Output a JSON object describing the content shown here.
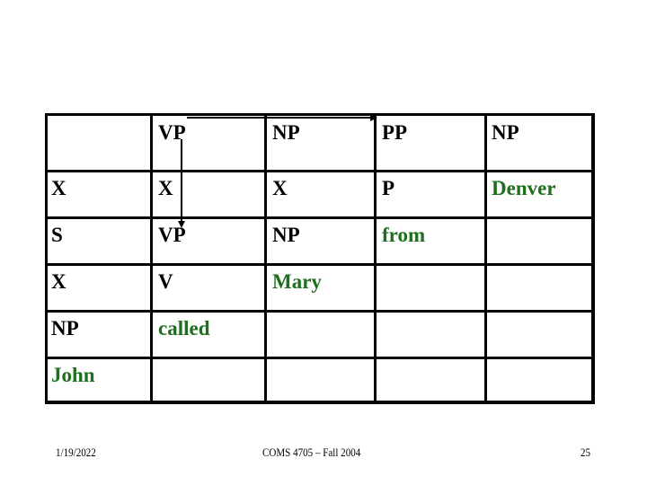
{
  "table": {
    "rows": [
      [
        "",
        "VP",
        "NP",
        "PP",
        "NP"
      ],
      [
        "X",
        "X",
        "X",
        "P",
        "Denver"
      ],
      [
        "S",
        "VP",
        "NP",
        "from",
        ""
      ],
      [
        "X",
        "V",
        "Mary",
        "",
        ""
      ],
      [
        "NP",
        "called",
        "",
        "",
        ""
      ],
      [
        "John",
        "",
        "",
        "",
        ""
      ]
    ],
    "word_color": "#1e6e1e",
    "label_color": "#000000"
  },
  "arrows": [
    {
      "from": "row0-col1",
      "to": "row0-col3",
      "direction": "horizontal"
    },
    {
      "from": "row0-col1",
      "to": "row2-col1",
      "direction": "vertical"
    }
  ],
  "footer": {
    "date": "1/19/2022",
    "course": "COMS 4705 – Fall 2004",
    "page": "25"
  }
}
